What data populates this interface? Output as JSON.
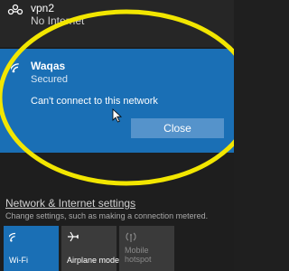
{
  "vpn": {
    "name": "vpn2",
    "status": "No Internet",
    "icon": "vpn-icon"
  },
  "wifi_network": {
    "name": "Waqas",
    "security": "Secured",
    "message": "Can't connect to this network",
    "close_label": "Close",
    "icon": "wifi-icon",
    "accent_color": "#1a6fb5"
  },
  "settings": {
    "link_label": "Network & Internet settings",
    "description": "Change settings, such as making a connection metered."
  },
  "quick_actions": [
    {
      "label": "Wi-Fi",
      "icon": "wifi-icon",
      "active": true
    },
    {
      "label": "Airplane mode",
      "icon": "airplane-icon",
      "active": false
    },
    {
      "label": "Mobile hotspot",
      "icon": "hotspot-icon",
      "active": false,
      "disabled": true
    }
  ],
  "highlight_color": "#f2e600"
}
